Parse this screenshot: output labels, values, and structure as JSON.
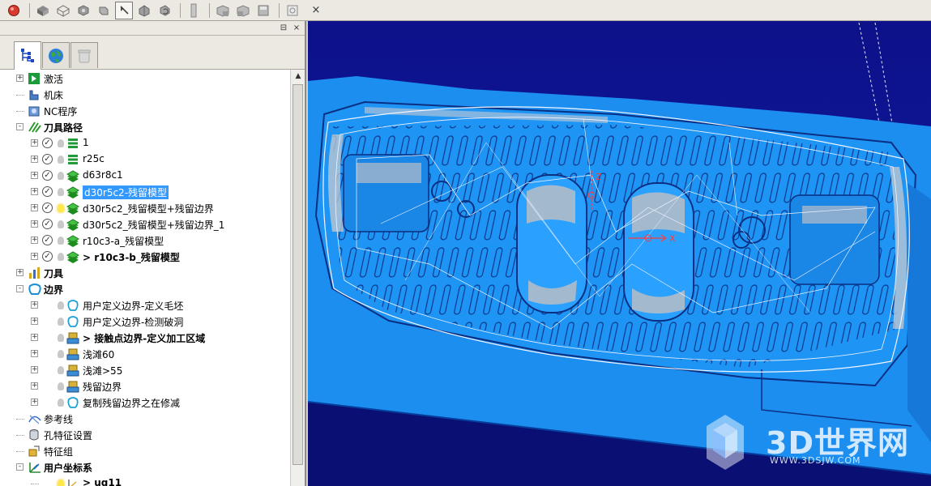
{
  "toolbar": {
    "buttons": [
      "stop-icon",
      "shaded-icon",
      "wireframe-icon",
      "material-icon",
      "select-icon",
      "rotate-icon",
      "refresh-icon",
      "ruler-icon",
      "save-view-icon",
      "load-view-icon",
      "save-icon",
      "reset-icon"
    ],
    "close": "×"
  },
  "panel": {
    "title_buttons": [
      "⊟",
      "×"
    ],
    "tabs": [
      "explorer-tab",
      "globe-tab",
      "bin-tab"
    ]
  },
  "tree": {
    "items": [
      {
        "label": "激活",
        "icon": "play-icon"
      },
      {
        "label": "机床",
        "icon": "machine-icon"
      },
      {
        "label": "NC程序",
        "icon": "nc-program-icon"
      },
      {
        "label": "刀具路径",
        "icon": "toolpaths-folder-icon"
      },
      {
        "label": "1",
        "icon": "toolpath-icon"
      },
      {
        "label": "r25c",
        "icon": "toolpath-icon"
      },
      {
        "label": "d63r8c1",
        "icon": "toolpath-icon"
      },
      {
        "label": "d30r5c2-残留模型",
        "icon": "toolpath-icon"
      },
      {
        "label": "d30r5c2_残留模型+残留边界",
        "icon": "toolpath-icon"
      },
      {
        "label": "d30r5c2_残留模型+残留边界_1",
        "icon": "toolpath-icon"
      },
      {
        "label": "r10c3-a_残留模型",
        "icon": "toolpath-icon"
      },
      {
        "label": "> r10c3-b_残留模型",
        "icon": "toolpath-icon"
      },
      {
        "label": "刀具",
        "icon": "tools-folder-icon"
      },
      {
        "label": "边界",
        "icon": "boundary-folder-icon"
      },
      {
        "label": "用户定义边界-定义毛坯",
        "icon": "boundary-icon"
      },
      {
        "label": "用户定义边界-检测破洞",
        "icon": "boundary-icon"
      },
      {
        "label": "> 接触点边界-定义加工区域",
        "icon": "contact-boundary-icon"
      },
      {
        "label": "浅滩60",
        "icon": "contact-boundary-icon"
      },
      {
        "label": "浅滩>55",
        "icon": "contact-boundary-icon"
      },
      {
        "label": "残留边界",
        "icon": "contact-boundary-icon"
      },
      {
        "label": "复制残留边界之在修减",
        "icon": "boundary-icon"
      },
      {
        "label": "参考线",
        "icon": "reference-line-icon"
      },
      {
        "label": "孔特征设置",
        "icon": "hole-feature-icon"
      },
      {
        "label": "特征组",
        "icon": "feature-group-icon"
      },
      {
        "label": "用户坐标系",
        "icon": "coordinate-system-icon"
      },
      {
        "label": "> ug11",
        "icon": "coordinate-icon"
      }
    ]
  },
  "viewport": {
    "axis_x": "X",
    "axis_z": "Z",
    "watermark": "3D世界网",
    "watermark_url": "WWW.3DSJW.COM"
  },
  "colors": {
    "part": "#1c8ef0",
    "background": "#10169a",
    "selection": "#3399ff"
  }
}
